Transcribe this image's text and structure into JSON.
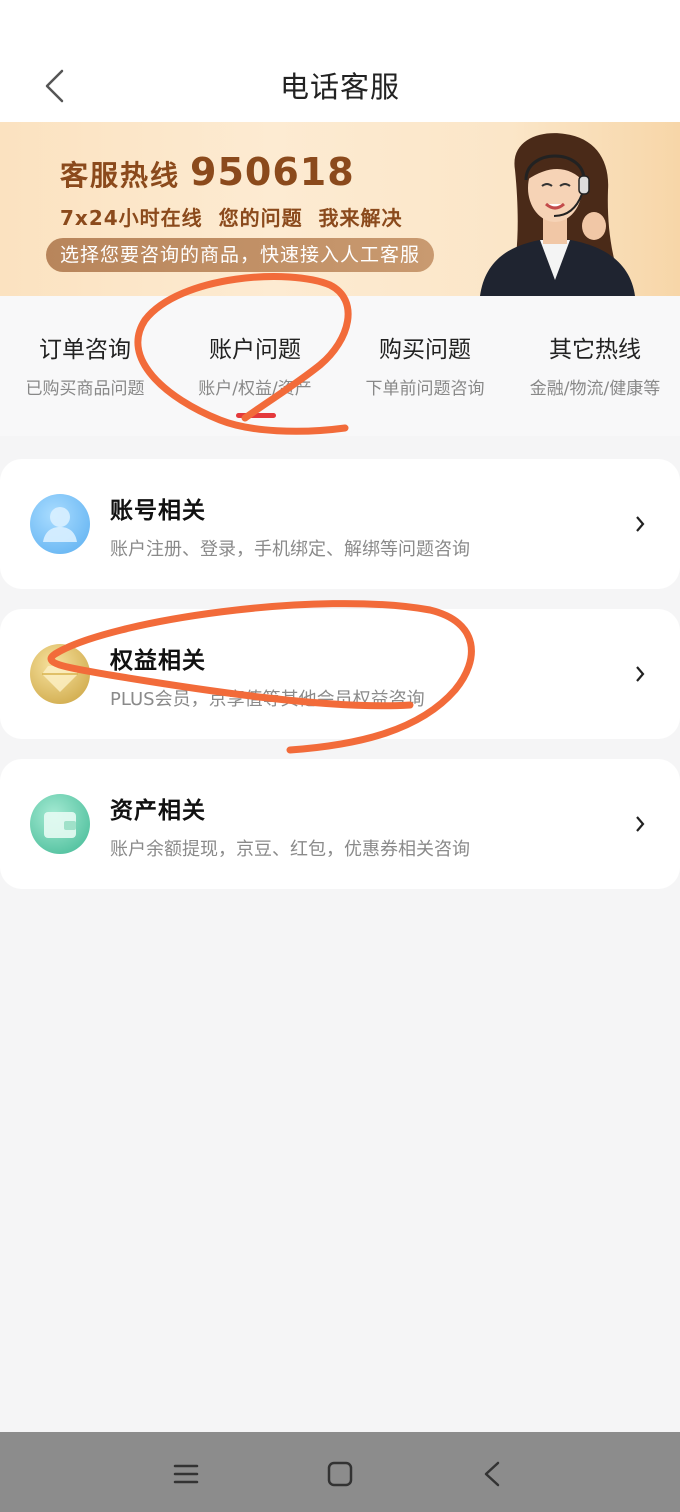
{
  "header": {
    "title": "电话客服",
    "back_icon": "chevron-left-icon"
  },
  "banner": {
    "hotline_label": "客服热线",
    "hotline_number": "950618",
    "tagline": "7x24小时在线  您的问题  我来解决",
    "pill_text": "选择您要咨询的商品，快速接入人工客服",
    "colors": {
      "text": "#8b4a1c",
      "pill": "#b8855b"
    }
  },
  "tabs": [
    {
      "title": "订单咨询",
      "subtitle": "已购买商品问题",
      "selected": false
    },
    {
      "title": "账户问题",
      "subtitle": "账户/权益/资产",
      "selected": true
    },
    {
      "title": "购买问题",
      "subtitle": "下单前问题咨询",
      "selected": false
    },
    {
      "title": "其它热线",
      "subtitle": "金融/物流/健康等",
      "selected": false
    }
  ],
  "cards": [
    {
      "title": "账号相关",
      "description": "账户注册、登录，手机绑定、解绑等问题咨询",
      "icon": "user-icon",
      "color": "#6ab8f0"
    },
    {
      "title": "权益相关",
      "description": "PLUS会员，京享值等其他会员权益咨询",
      "icon": "diamond-icon",
      "color": "#d8b24c"
    },
    {
      "title": "资产相关",
      "description": "账户余额提现，京豆、红包，优惠券相关咨询",
      "icon": "wallet-icon",
      "color": "#4fc6a4"
    }
  ],
  "annotations": {
    "color": "#f26b3a"
  },
  "navbar": {
    "icons": [
      "menu-icon",
      "home-square-icon",
      "back-triangle-icon"
    ]
  },
  "colors": {
    "accent": "#e4393c",
    "background": "#f5f5f6"
  }
}
